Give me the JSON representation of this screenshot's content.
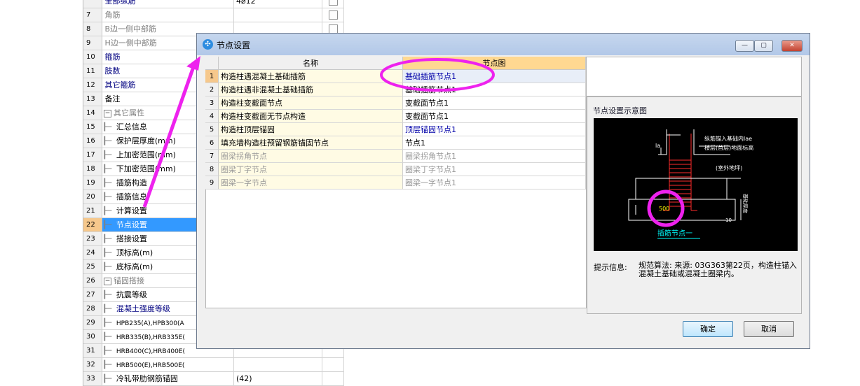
{
  "background_grid": {
    "rows": [
      {
        "num": "",
        "name": "全部纵筋",
        "value": "4⌀12",
        "style": "blue",
        "check": true
      },
      {
        "num": "7",
        "name": "角筋",
        "value": "",
        "style": "gray",
        "check": true
      },
      {
        "num": "8",
        "name": "B边一侧中部筋",
        "value": "",
        "style": "gray",
        "check": true
      },
      {
        "num": "9",
        "name": "H边一侧中部筋",
        "value": "",
        "style": "gray",
        "check": true
      },
      {
        "num": "10",
        "name": "箍筋",
        "value": "",
        "style": "blue",
        "check": false
      },
      {
        "num": "11",
        "name": "肢数",
        "value": "",
        "style": "blue",
        "check": false
      },
      {
        "num": "12",
        "name": "其它箍筋",
        "value": "",
        "style": "blue",
        "check": false
      },
      {
        "num": "13",
        "name": "备注",
        "value": "",
        "style": "normal",
        "check": false
      },
      {
        "num": "14",
        "name": "其它属性",
        "value": "",
        "style": "gray",
        "check": false,
        "toggle": "−"
      },
      {
        "num": "15",
        "name": "汇总信息",
        "value": "",
        "style": "normal",
        "check": false,
        "tree": true
      },
      {
        "num": "16",
        "name": "保护层厚度(mm)",
        "value": "",
        "style": "normal",
        "check": false,
        "tree": true
      },
      {
        "num": "17",
        "name": "上加密范围(mm)",
        "value": "",
        "style": "normal",
        "check": false,
        "tree": true
      },
      {
        "num": "18",
        "name": "下加密范围(mm)",
        "value": "",
        "style": "normal",
        "check": false,
        "tree": true
      },
      {
        "num": "19",
        "name": "插筋构造",
        "value": "",
        "style": "normal",
        "check": false,
        "tree": true
      },
      {
        "num": "20",
        "name": "插筋信息",
        "value": "",
        "style": "normal",
        "check": false,
        "tree": true
      },
      {
        "num": "21",
        "name": "计算设置",
        "value": "",
        "style": "normal",
        "check": false,
        "tree": true
      },
      {
        "num": "22",
        "name": "节点设置",
        "value": "",
        "style": "normal",
        "check": false,
        "tree": true,
        "selected": true
      },
      {
        "num": "23",
        "name": "搭接设置",
        "value": "",
        "style": "normal",
        "check": false,
        "tree": true
      },
      {
        "num": "24",
        "name": "顶标高(m)",
        "value": "",
        "style": "normal",
        "check": false,
        "tree": true
      },
      {
        "num": "25",
        "name": "底标高(m)",
        "value": "",
        "style": "normal",
        "check": false,
        "tree": true
      },
      {
        "num": "26",
        "name": "锚固搭接",
        "value": "",
        "style": "gray",
        "check": false,
        "toggle": "−"
      },
      {
        "num": "27",
        "name": "抗震等级",
        "value": "",
        "style": "normal",
        "check": false,
        "tree": true
      },
      {
        "num": "28",
        "name": "混凝土强度等级",
        "value": "",
        "style": "blue",
        "check": false,
        "tree": true
      },
      {
        "num": "29",
        "name": "HPB235(A),HPB300(A",
        "value": "",
        "style": "normal",
        "check": false,
        "tree": true,
        "small": true
      },
      {
        "num": "30",
        "name": "HRB335(B),HRB335E(",
        "value": "",
        "style": "normal",
        "check": false,
        "tree": true,
        "small": true
      },
      {
        "num": "31",
        "name": "HRB400(C),HRB400E(",
        "value": "",
        "style": "normal",
        "check": false,
        "tree": true,
        "small": true
      },
      {
        "num": "32",
        "name": "HRB500(E),HRB500E(",
        "value": "",
        "style": "normal",
        "check": false,
        "tree": true,
        "small": true
      },
      {
        "num": "33",
        "name": "冷轧带肋钢筋锚固",
        "value": "(42)",
        "style": "normal",
        "check": false,
        "tree": true
      }
    ]
  },
  "dialog": {
    "title": "节点设置",
    "window_buttons": {
      "minimize": "—",
      "maximize": "▢",
      "close": "✕"
    },
    "table": {
      "headers": {
        "name": "名称",
        "diagram": "节点图"
      },
      "rows": [
        {
          "num": "1",
          "name": "构造柱遇混凝土基础插筋",
          "node": "基础插筋节点1",
          "link": true,
          "active": true
        },
        {
          "num": "2",
          "name": "构造柱遇非混凝土基础插筋",
          "node": "基础插筋节点1",
          "link": false
        },
        {
          "num": "3",
          "name": "构造柱变截面节点",
          "node": "变截面节点1",
          "link": false
        },
        {
          "num": "4",
          "name": "构造柱变截面无节点构造",
          "node": "变截面节点1",
          "link": false
        },
        {
          "num": "5",
          "name": "构造柱顶层锚固",
          "node": "顶层锚固节点1",
          "link": true
        },
        {
          "num": "6",
          "name": "填充墙构造柱预留钢筋锚固节点",
          "node": "节点1",
          "link": false
        },
        {
          "num": "7",
          "name": "圈梁拐角节点",
          "node": "圈梁拐角节点1",
          "dim": true
        },
        {
          "num": "8",
          "name": "圈梁丁字节点",
          "node": "圈梁丁字节点1",
          "dim": true
        },
        {
          "num": "9",
          "name": "圈梁一字节点",
          "node": "圈梁一字节点1",
          "dim": true
        }
      ]
    },
    "preview": {
      "title": "节点设置示意图",
      "diagram_texts": {
        "anchor_note": "纵筋锚入基础内lae",
        "floor_note": "楼层(首层)地面标高",
        "outdoor_note": "(室外地坪)",
        "side_label": "基础厚度",
        "dim_value": "500",
        "caption": "插筋节点一",
        "la_label": "la",
        "ld_label": "10"
      }
    },
    "hint": {
      "label": "提示信息:",
      "text": "规范算法: 来源: 03G363第22页，构造柱锚入混凝土基础或混凝土圈梁内。"
    },
    "ok_label": "确定",
    "cancel_label": "取消"
  },
  "annotation_color": "#ee22ee"
}
